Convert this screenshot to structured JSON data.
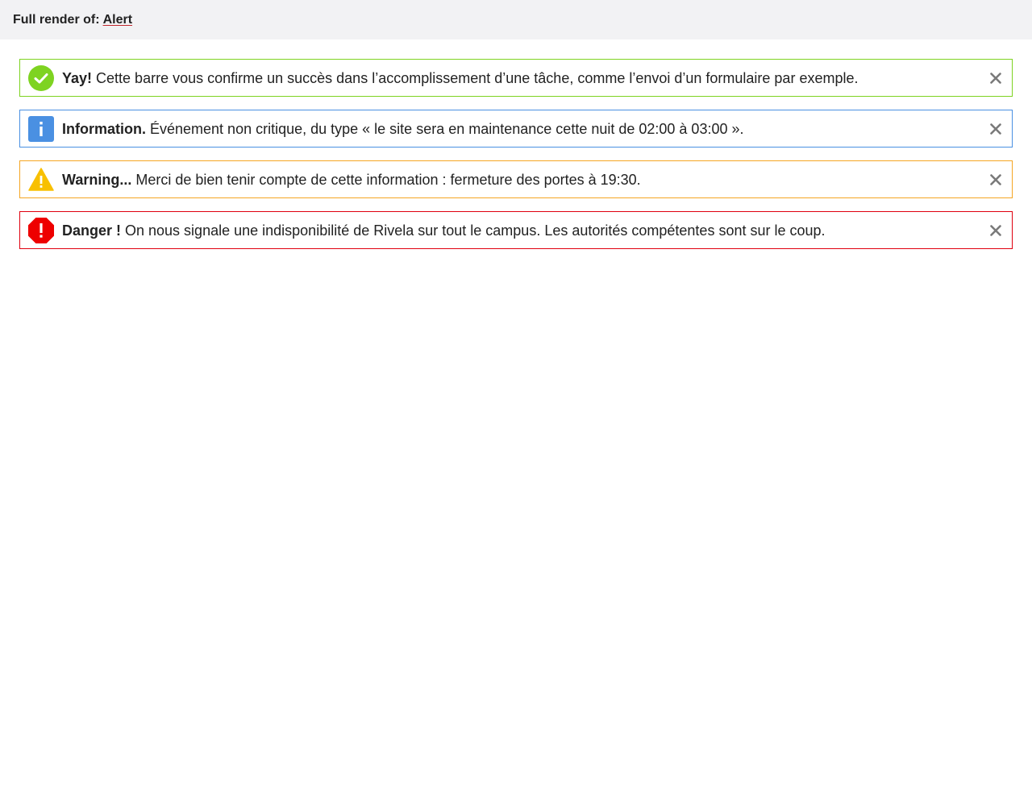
{
  "header": {
    "prefix": "Full render of:",
    "link_label": "Alert"
  },
  "alerts": [
    {
      "type": "success",
      "icon": "check-circle-icon",
      "color": "#7ed321",
      "title": "Yay!",
      "message": "Cette barre vous confirme un succès dans l’accomplissement d’une tâche, comme l’envoi d’un formulaire par exemple."
    },
    {
      "type": "info",
      "icon": "info-square-icon",
      "color": "#4a90e2",
      "title": "Information.",
      "message": "Événement non critique, du type « le site sera en maintenance cette nuit de 02:00 à 03:00 »."
    },
    {
      "type": "warning",
      "icon": "warning-triangle-icon",
      "color": "#f5a623",
      "title": "Warning...",
      "message": "Merci de bien tenir compte de cette information : fermeture des portes à 19:30."
    },
    {
      "type": "danger",
      "icon": "danger-octagon-icon",
      "color": "#e0000f",
      "title": "Danger !",
      "message": "On nous signale une indisponibilité de Rivela sur tout le campus. Les autorités compétentes sont sur le coup."
    }
  ],
  "close_icon": "close-icon"
}
